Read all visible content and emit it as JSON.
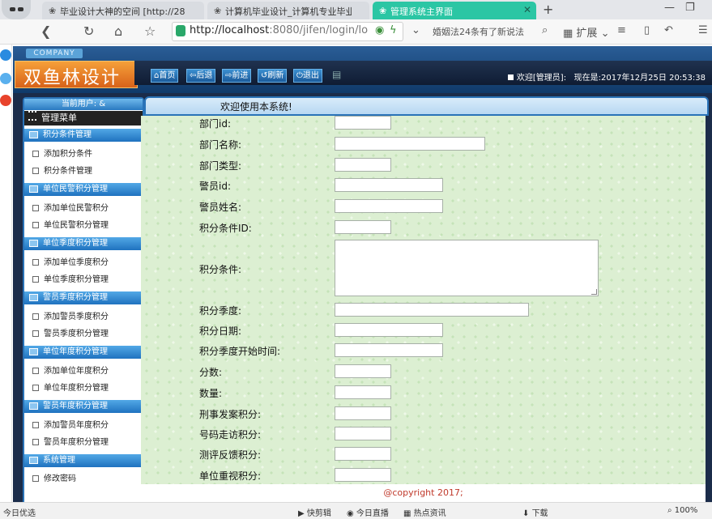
{
  "browser": {
    "tabs": [
      {
        "title": "毕业设计大神的空间 [http://28",
        "icon": "paw-icon"
      },
      {
        "title": "计算机毕业设计_计算机专业毕业",
        "icon": "paw-icon"
      },
      {
        "title": "管理系统主界面",
        "icon": "paw-icon"
      }
    ],
    "new_tab": "+",
    "url_host": "http://localhost",
    "url_rest": ":8080/jifen/login/lo",
    "news_ticker": "婚姻法24条有了新说法",
    "extensions_label": "扩展",
    "status_left": "今日优选",
    "status_items": [
      "快剪辑",
      "今日直播",
      "热点资讯",
      "下载",
      "100%"
    ]
  },
  "app": {
    "company_tag": "COMPANY",
    "logo_text": "双鱼林设计",
    "toolbar": {
      "home": "首页",
      "back": "后退",
      "forward": "前进",
      "refresh": "刷新",
      "logout": "退出"
    },
    "welcome": "欢迎[管理员]:",
    "now_label": "现在是:",
    "datetime": "2017年12月25日 20:53:38",
    "current_user_label": "当前用户: &",
    "menu_title": "管理菜单",
    "menu_groups": [
      {
        "title": "积分条件管理",
        "items": [
          "添加积分条件",
          "积分条件管理"
        ]
      },
      {
        "title": "单位民警积分管理",
        "items": [
          "添加单位民警积分",
          "单位民警积分管理"
        ]
      },
      {
        "title": "单位季度积分管理",
        "items": [
          "添加单位季度积分",
          "单位季度积分管理"
        ]
      },
      {
        "title": "警员季度积分管理",
        "items": [
          "添加警员季度积分",
          "警员季度积分管理"
        ]
      },
      {
        "title": "单位年度积分管理",
        "items": [
          "添加单位年度积分",
          "单位年度积分管理"
        ]
      },
      {
        "title": "警员年度积分管理",
        "items": [
          "添加警员年度积分",
          "警员年度积分管理"
        ]
      },
      {
        "title": "系统管理",
        "items": [
          "修改密码"
        ]
      }
    ],
    "content_title": "欢迎使用本系统!",
    "form_fields": [
      {
        "label": "部门id:",
        "value": ""
      },
      {
        "label": "部门名称:",
        "value": ""
      },
      {
        "label": "部门类型:",
        "value": ""
      },
      {
        "label": "警员id:",
        "value": ""
      },
      {
        "label": "警员姓名:",
        "value": ""
      },
      {
        "label": "积分条件ID:",
        "value": ""
      },
      {
        "label": "积分条件:",
        "value": ""
      },
      {
        "label": "积分季度:",
        "value": ""
      },
      {
        "label": "积分日期:",
        "value": ""
      },
      {
        "label": "积分季度开始时间:",
        "value": ""
      },
      {
        "label": "分数:",
        "value": ""
      },
      {
        "label": "数量:",
        "value": ""
      },
      {
        "label": "刑事发案积分:",
        "value": ""
      },
      {
        "label": "号码走访积分:",
        "value": ""
      },
      {
        "label": "测评反馈积分:",
        "value": ""
      },
      {
        "label": "单位重视积分:",
        "value": ""
      }
    ],
    "footer": "@copyright 2017;"
  }
}
